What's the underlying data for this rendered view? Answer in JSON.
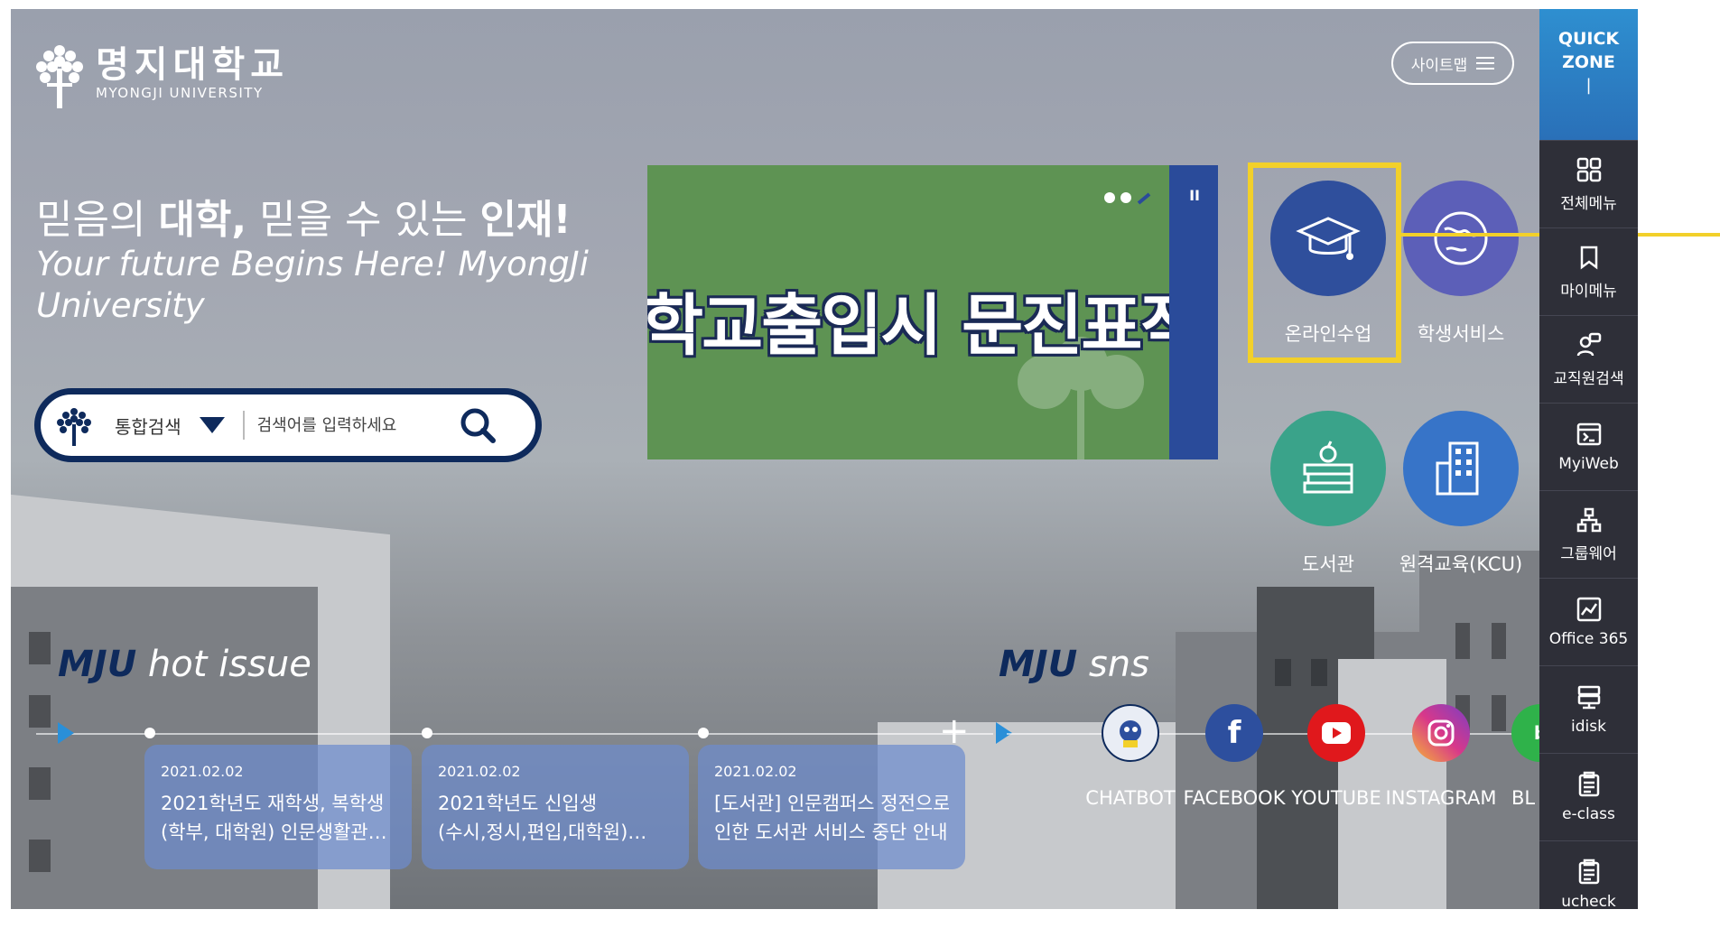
{
  "header": {
    "logo_ko": "명지대학교",
    "logo_en": "MYONGJI UNIVERSITY",
    "sitemap_label": "사이트맵"
  },
  "slogan": {
    "ko_part1": "믿음의 ",
    "ko_bold1": "대학,",
    "ko_part2": " 믿을 수 있는 ",
    "ko_bold2": "인재!",
    "en": "Your future Begins Here! MyongJi University"
  },
  "search": {
    "category": "통합검색",
    "placeholder": "검색어를 입력하세요"
  },
  "banner": {
    "text": "학교출입시 문진표작성"
  },
  "quick_icons": [
    {
      "label": "온라인수업",
      "color": "#2f4f9c",
      "icon": "graduation-cap-icon"
    },
    {
      "label": "학생서비스",
      "color": "#5c5fb8",
      "icon": "globe-icon"
    },
    {
      "label": "도서관",
      "color": "#3aa38a",
      "icon": "books-icon"
    },
    {
      "label": "원격교육(KCU)",
      "color": "#3774c8",
      "icon": "building-icon"
    }
  ],
  "quickzone": {
    "title_line1": "QUICK",
    "title_line2": "ZONE",
    "items": [
      {
        "label": "전체메뉴",
        "icon": "grid-icon"
      },
      {
        "label": "마이메뉴",
        "icon": "bookmark-icon"
      },
      {
        "label": "교직원검색",
        "icon": "person-search-icon"
      },
      {
        "label": "MyiWeb",
        "icon": "terminal-icon"
      },
      {
        "label": "그룹웨어",
        "icon": "org-chart-icon"
      },
      {
        "label": "Office 365",
        "icon": "chart-window-icon"
      },
      {
        "label": "idisk",
        "icon": "server-icon"
      },
      {
        "label": "e-class",
        "icon": "clipboard-icon"
      },
      {
        "label": "ucheck",
        "icon": "clipboard-check-icon"
      }
    ]
  },
  "hot_issue": {
    "title_bold": "MJU",
    "title_rest": " hot issue",
    "items": [
      {
        "date": "2021.02.02",
        "line1": "2021학년도 재학생, 복학생",
        "line2": "(학부, 대학원) 인문생활관…"
      },
      {
        "date": "2021.02.02",
        "line1": "2021학년도 신입생",
        "line2": "(수시,정시,편입,대학원)…"
      },
      {
        "date": "2021.02.02",
        "line1": "[도서관] 인문캠퍼스 정전으로",
        "line2": "인한 도서관 서비스 중단 안내"
      }
    ],
    "more_label": "+"
  },
  "sns": {
    "title_bold": "MJU",
    "title_rest": " sns",
    "items": [
      {
        "label": "CHATBOT",
        "color": "#e9edf5"
      },
      {
        "label": "FACEBOOK",
        "color": "#2d4f9e"
      },
      {
        "label": "YOUTUBE",
        "color": "#e0181c"
      },
      {
        "label": "INSTAGRAM",
        "color": "#d8388a"
      },
      {
        "label": "BL",
        "color": "#2fb24a"
      }
    ]
  },
  "colors": {
    "navy": "#0e2a5c",
    "highlight": "#f2d02a",
    "banner_green": "#5e9353",
    "sidebar": "#2e2f38",
    "quickzone_blue": "#2e8fd0"
  }
}
